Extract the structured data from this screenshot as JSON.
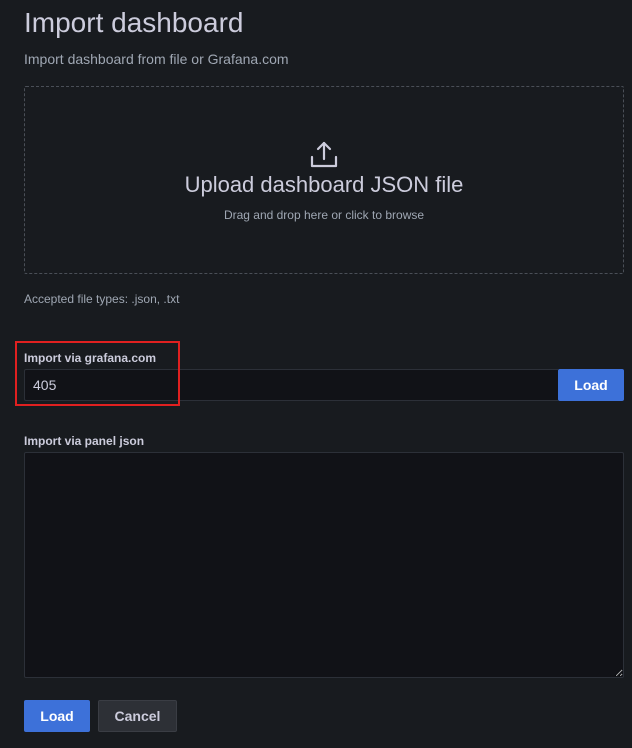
{
  "page": {
    "title": "Import dashboard",
    "subtitle": "Import dashboard from file or Grafana.com"
  },
  "upload": {
    "icon": "upload-icon",
    "title": "Upload dashboard JSON file",
    "hint": "Drag and drop here or click to browse",
    "accepted_types": "Accepted file types: .json, .txt"
  },
  "grafana_import": {
    "label": "Import via grafana.com",
    "value": "405",
    "load_label": "Load"
  },
  "panel_json": {
    "label": "Import via panel json",
    "value": ""
  },
  "footer": {
    "load_label": "Load",
    "cancel_label": "Cancel"
  },
  "colors": {
    "background": "#181b1f",
    "primary": "#3d71d9",
    "highlight": "#e02020"
  }
}
